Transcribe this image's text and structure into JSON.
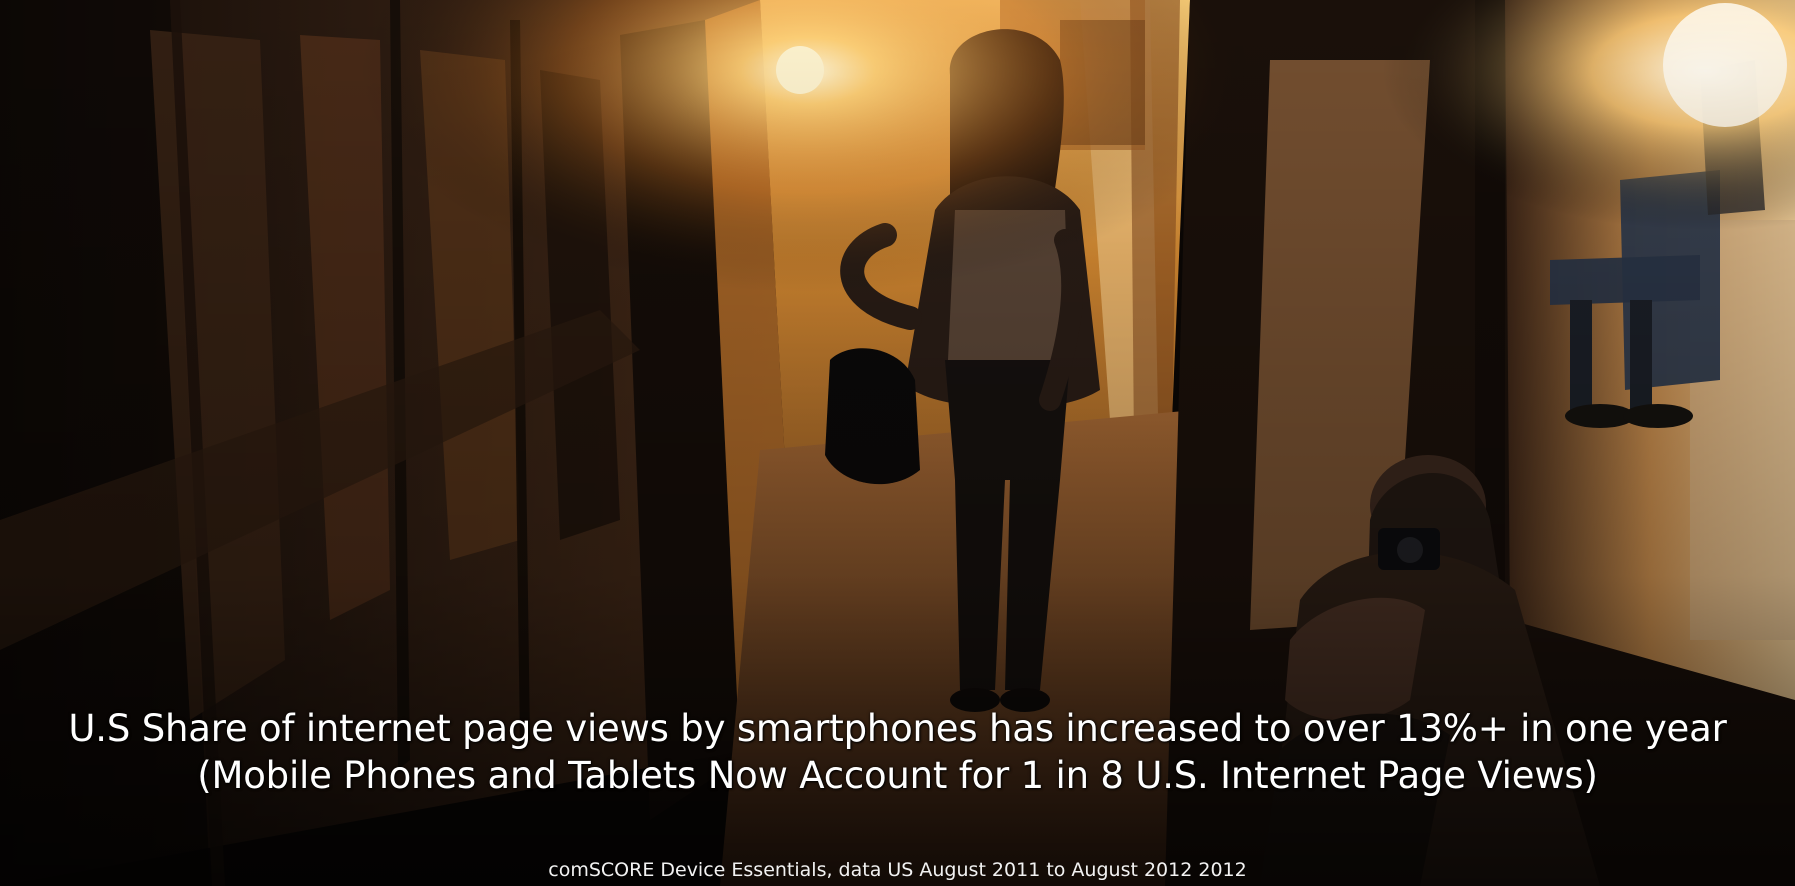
{
  "slide": {
    "headline_line1": "U.S Share of internet page views by smartphones has increased to over 13%+ in one year",
    "headline_line2": "(Mobile Phones and Tablets Now Account for 1 in 8 U.S. Internet Page Views)",
    "source": "comSCORE Device Essentials,  data US August 2011 to August 2012 2012"
  },
  "photo": {
    "palette": {
      "dark_wall": "#1a120d",
      "wood": "#3a2417",
      "glow": "#ffb347",
      "light": "#fff2c2",
      "floor": "#7a4b28"
    }
  }
}
